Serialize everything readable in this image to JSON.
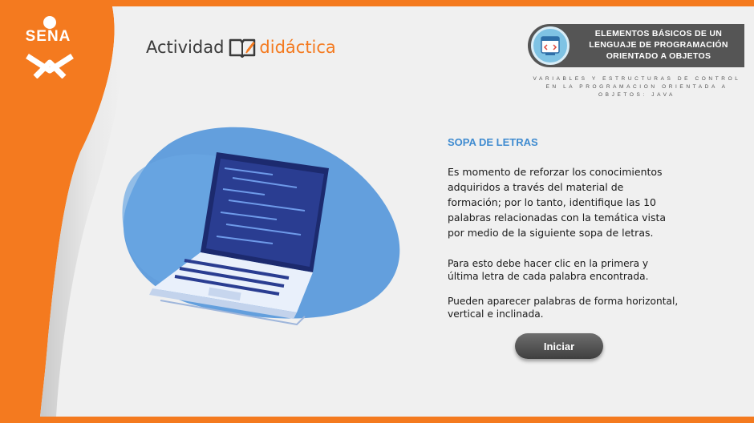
{
  "logo": {
    "text": "SENA"
  },
  "brand": {
    "left": "Actividad",
    "right": "didáctica"
  },
  "topic": {
    "title": "ELEMENTOS BÁSICOS DE UN LENGUAJE DE PROGRAMACIÓN ORIENTADO A OBJETOS",
    "subtitle": "Variables y estructuras de control en la programacion orientada a objetos: java",
    "icon": "code-window-icon"
  },
  "content": {
    "title": "SOPA DE LETRAS",
    "paragraph1": "Es momento de reforzar los conocimientos adquiridos a través del material de formación; por lo tanto, identifique las 10 palabras relacionadas con la temática vista por medio de la siguiente sopa de letras.",
    "paragraph2": "Para esto debe hacer clic en la primera y última letra de cada palabra encontrada.",
    "paragraph3": "Pueden aparecer palabras de forma horizontal, vertical e inclinada."
  },
  "start_button": {
    "label": "Iniciar"
  },
  "colors": {
    "accent": "#f47a1f",
    "title_blue": "#3f8bd0",
    "panel_gray": "#555555",
    "blob_blue": "#4a90d9"
  }
}
